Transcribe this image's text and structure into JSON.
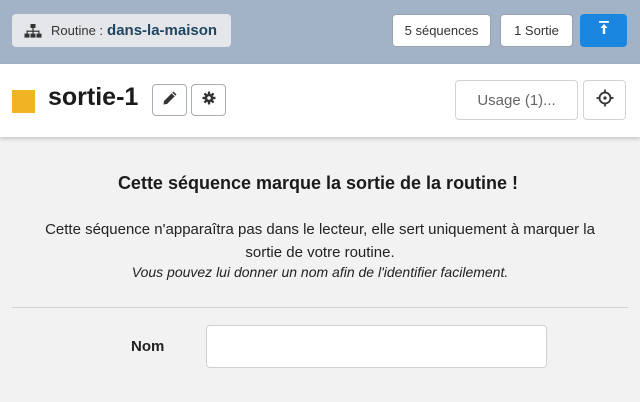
{
  "topbar": {
    "routine_prefix": "Routine :",
    "routine_name": "dans-la-maison",
    "routine_icon": "sitemap-icon",
    "sequences_button": "5 séquences",
    "sortie_button": "1 Sortie",
    "up_button_icon": "arrow-up-icon",
    "up_button_color": "#1a86e0"
  },
  "header": {
    "color_swatch": "#f0b323",
    "title": "sortie-1",
    "edit_icon": "pencil-icon",
    "settings_icon": "gear-icon",
    "usage_button": "Usage (1)...",
    "locate_icon": "crosshair-icon"
  },
  "content": {
    "heading": "Cette séquence marque la sortie de la routine !",
    "description": "Cette séquence n'apparaîtra pas dans le lecteur, elle sert uniquement à marquer la sortie de votre routine.",
    "hint": "Vous pouvez lui donner un nom afin de l'identifier facilement.",
    "name_label": "Nom",
    "name_value": "",
    "name_placeholder": ""
  }
}
